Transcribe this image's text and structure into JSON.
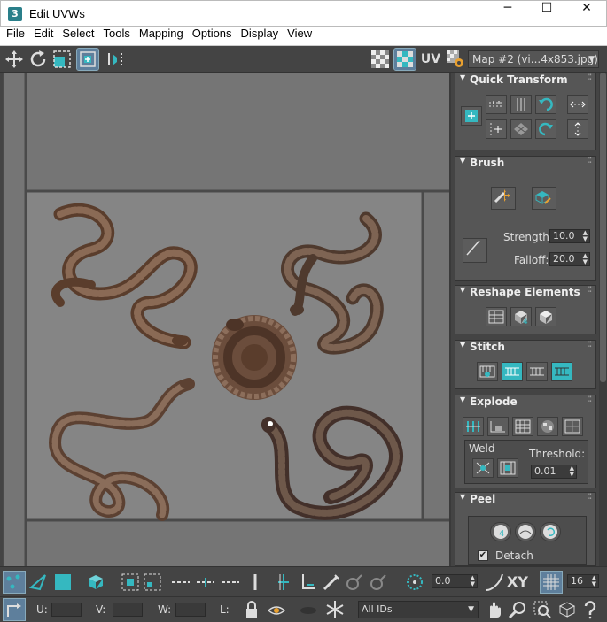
{
  "window": {
    "app_icon": "3",
    "title": "Edit UVWs",
    "minimize": "─",
    "maximize": "☐",
    "close": "✕"
  },
  "menu": [
    "File",
    "Edit",
    "Select",
    "Tools",
    "Mapping",
    "Options",
    "Display",
    "View"
  ],
  "toolbar": {
    "uv_label": "UV",
    "map_dropdown": "Map #2 (vi...4x853.jpg)"
  },
  "panels": {
    "quick_transform": "Quick Transform",
    "brush": {
      "title": "Brush",
      "strength_label": "Strength:",
      "strength_value": "10.0",
      "falloff_label": "Falloff:",
      "falloff_value": "20.0"
    },
    "reshape": "Reshape Elements",
    "stitch": "Stitch",
    "explode": {
      "title": "Explode",
      "weld_label": "Weld",
      "threshold_label": "Threshold:",
      "threshold_value": "0.01"
    },
    "peel": {
      "title": "Peel",
      "detach_label": "Detach"
    }
  },
  "bottom": {
    "rotate_value": "0.0",
    "xy_label": "XY",
    "grid_value": "16",
    "u_label": "U:",
    "v_label": "V:",
    "w_label": "W:",
    "l_label": "L:",
    "ids_dropdown": "All IDs"
  },
  "colors": {
    "accent": "#35b8c0",
    "canvas": "#757575",
    "panel": "#565656"
  },
  "icons": [
    "move-icon",
    "rotate-icon",
    "scale-icon",
    "freeform-icon",
    "mirror-icon",
    "checker-icon",
    "texture-icon",
    "settings-icon",
    "pan-icon",
    "zoom-icon",
    "lock-icon",
    "snowflake-icon",
    "help-icon"
  ]
}
